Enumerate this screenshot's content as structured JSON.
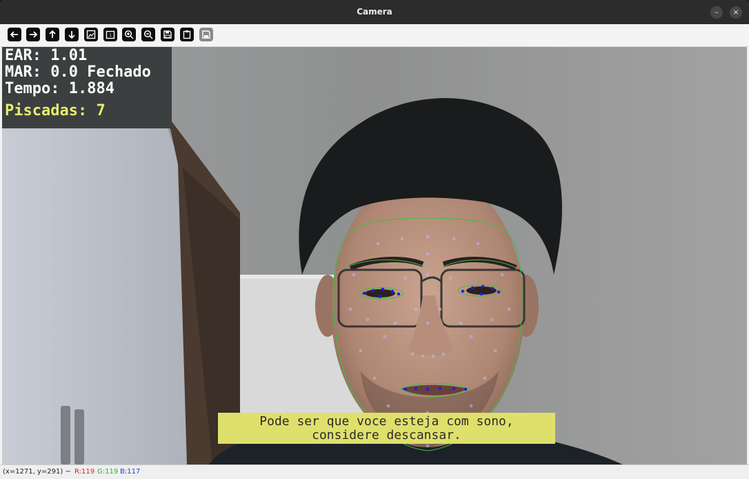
{
  "window": {
    "title": "Camera",
    "minimize_label": "–",
    "close_label": "×"
  },
  "toolbar": {
    "buttons": [
      {
        "icon": "arrow-left-icon",
        "tooltip": ""
      },
      {
        "icon": "arrow-right-icon",
        "tooltip": ""
      },
      {
        "icon": "arrow-up-icon",
        "tooltip": ""
      },
      {
        "icon": "arrow-down-icon",
        "tooltip": ""
      },
      {
        "icon": "zoom-fit-icon",
        "tooltip": ""
      },
      {
        "icon": "zoom-original-icon",
        "tooltip": ""
      },
      {
        "icon": "zoom-in-icon",
        "tooltip": ""
      },
      {
        "icon": "zoom-out-icon",
        "tooltip": ""
      },
      {
        "icon": "save-icon",
        "tooltip": ""
      },
      {
        "icon": "clipboard-icon",
        "tooltip": ""
      },
      {
        "icon": "properties-icon",
        "tooltip": ""
      }
    ]
  },
  "overlay": {
    "ear": "EAR: 1.01",
    "mar": "MAR: 0.0 Fechado",
    "tempo": "Tempo: 1.884",
    "piscadas": "Piscadas: 7",
    "message_line1": "Pode ser que voce esteja com sono,",
    "message_line2": "considere descansar."
  },
  "status": {
    "coords": "(x=1271, y=291) ~",
    "r": "R:119",
    "g": "G:119",
    "b": "B:117"
  },
  "colors": {
    "panel": "#3c3f3f",
    "yellow_text": "#e8ec6e",
    "message_bg": "#dfe06b",
    "mesh_green": "#3fbf3f",
    "mesh_blue": "#1a1aff"
  }
}
